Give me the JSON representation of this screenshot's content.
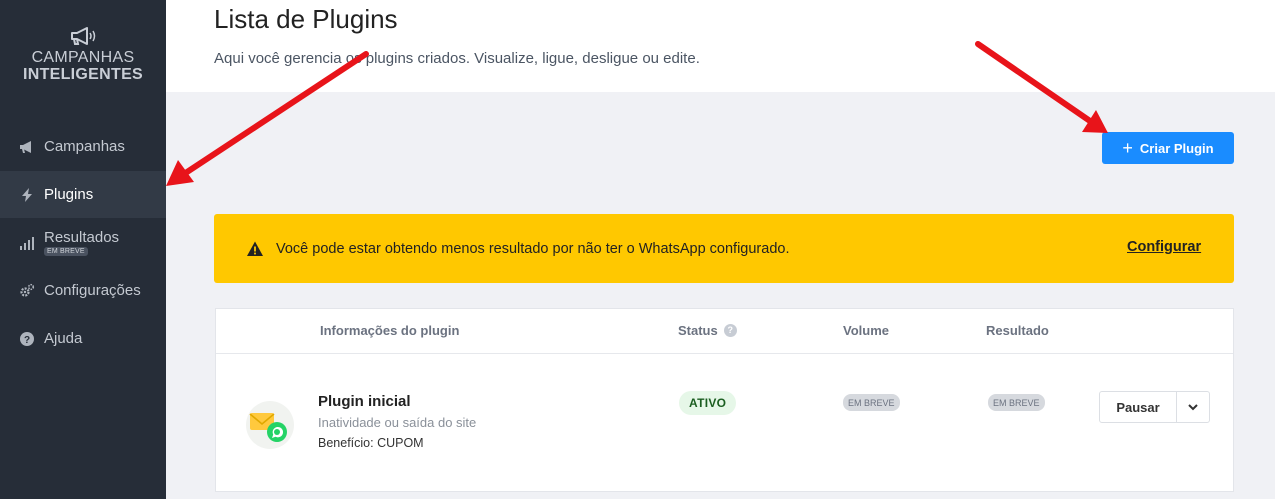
{
  "brand": {
    "line1": "CAMPANHAS",
    "line2": "INTELIGENTES",
    "icon": "megaphone-icon"
  },
  "sidebar": {
    "items": [
      {
        "label": "Campanhas",
        "icon": "megaphone-icon",
        "active": false
      },
      {
        "label": "Plugins",
        "icon": "bolt-icon",
        "active": true
      },
      {
        "label": "Resultados",
        "icon": "bar-chart-icon",
        "badge": "EM BREVE",
        "active": false
      },
      {
        "label": "Configurações",
        "icon": "gears-icon",
        "active": false
      },
      {
        "label": "Ajuda",
        "icon": "question-circle-icon",
        "active": false
      }
    ]
  },
  "header": {
    "title": "Lista de Plugins",
    "subtitle": "Aqui você gerencia os plugins criados. Visualize, ligue, desligue ou edite."
  },
  "actions": {
    "create_label": "Criar Plugin"
  },
  "alert": {
    "message": "Você pode estar obtendo menos resultado por não ter o WhatsApp configurado.",
    "link": "Configurar"
  },
  "table": {
    "columns": [
      "Informações do plugin",
      "Status",
      "Volume",
      "Resultado"
    ],
    "rows": [
      {
        "name": "Plugin inicial",
        "description": "Inatividade ou saída do site",
        "benefit": "Benefício: CUPOM",
        "status": "ATIVO",
        "volume": "EM BREVE",
        "result": "EM BREVE",
        "action": "Pausar"
      }
    ]
  },
  "colors": {
    "sidebar": "#262d38",
    "accent": "#1a8cff",
    "alert": "#ffc800",
    "arrow": "#e8141a"
  }
}
